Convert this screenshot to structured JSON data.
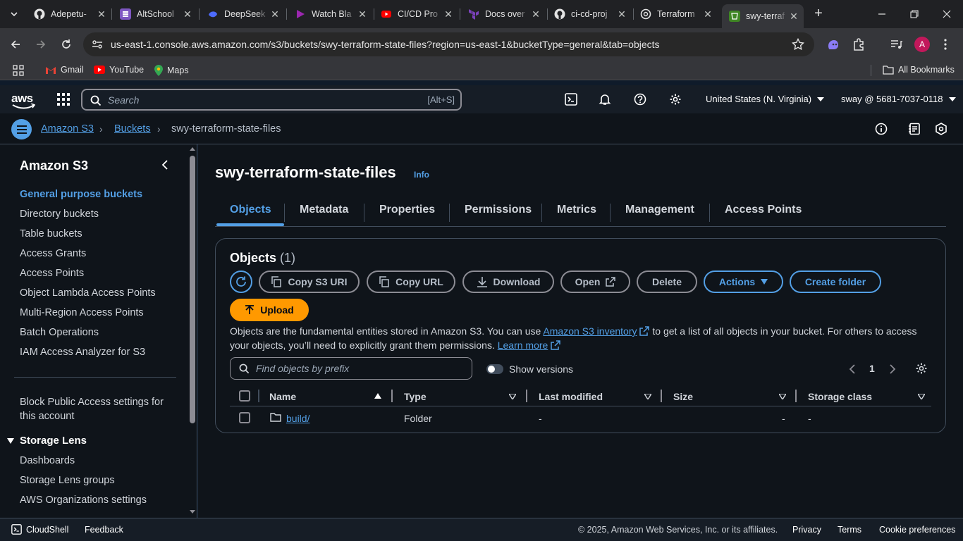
{
  "browser": {
    "tabs": [
      {
        "title": "Adepetu-",
        "icon": "github-icon",
        "color": "#e3e3e3"
      },
      {
        "title": "AltSchool",
        "icon": "altschool-icon",
        "color": "#7e57c2"
      },
      {
        "title": "DeepSeek",
        "icon": "deepseek-icon",
        "color": "#4d6bfe"
      },
      {
        "title": "Watch Bla",
        "icon": "play-icon",
        "color": "#9c27b0"
      },
      {
        "title": "CI/CD Pro",
        "icon": "youtube-icon",
        "color": "#ff0000"
      },
      {
        "title": "Docs over",
        "icon": "terraform-icon",
        "color": "#7b42bc"
      },
      {
        "title": "ci-cd-proj",
        "icon": "github-icon",
        "color": "#e3e3e3"
      },
      {
        "title": "Terraform",
        "icon": "openai-icon",
        "color": "#e3e3e3"
      },
      {
        "title": "swy-terraf",
        "icon": "s3-icon",
        "color": "#3f8624"
      }
    ],
    "url": "us-east-1.console.aws.amazon.com/s3/buckets/swy-terraform-state-files?region=us-east-1&bucketType=general&tab=objects",
    "profile_initial": "A",
    "bookmarks": [
      {
        "label": "Gmail",
        "icon": "gmail-icon"
      },
      {
        "label": "YouTube",
        "icon": "youtube-icon"
      },
      {
        "label": "Maps",
        "icon": "maps-icon"
      }
    ],
    "all_bookmarks": "All Bookmarks"
  },
  "aws": {
    "logo": "aws",
    "search_placeholder": "Search",
    "search_shortcut": "[Alt+S]",
    "region": "United States (N. Virginia)",
    "account": "sway @ 5681-7037-0118",
    "breadcrumbs": [
      "Amazon S3",
      "Buckets",
      "swy-terraform-state-files"
    ]
  },
  "sidebar": {
    "title": "Amazon S3",
    "items": [
      "General purpose buckets",
      "Directory buckets",
      "Table buckets",
      "Access Grants",
      "Access Points",
      "Object Lambda Access Points",
      "Multi-Region Access Points",
      "Batch Operations",
      "IAM Access Analyzer for S3"
    ],
    "block_public_access": "Block Public Access settings for this account",
    "storage_lens": {
      "title": "Storage Lens",
      "items": [
        "Dashboards",
        "Storage Lens groups",
        "AWS Organizations settings"
      ]
    }
  },
  "main": {
    "bucket_name": "swy-terraform-state-files",
    "info": "Info",
    "tabs": [
      "Objects",
      "Metadata",
      "Properties",
      "Permissions",
      "Metrics",
      "Management",
      "Access Points"
    ],
    "objects_title": "Objects",
    "objects_count": "(1)",
    "buttons": {
      "copy_s3_uri": "Copy S3 URI",
      "copy_url": "Copy URL",
      "download": "Download",
      "open": "Open",
      "delete": "Delete",
      "actions": "Actions",
      "create_folder": "Create folder",
      "upload": "Upload"
    },
    "description_1": "Objects are the fundamental entities stored in Amazon S3. You can use ",
    "inventory_link": "Amazon S3 inventory",
    "description_2": " to get a list of all objects in your bucket. For others to access your objects, you’ll need to explicitly grant them permissions. ",
    "learn_more": "Learn more",
    "search_placeholder": "Find objects by prefix",
    "show_versions": "Show versions",
    "page": "1",
    "columns": [
      "Name",
      "Type",
      "Last modified",
      "Size",
      "Storage class"
    ],
    "rows": [
      {
        "name": "build/",
        "type": "Folder",
        "last_modified": "-",
        "size": "-",
        "storage_class": "-"
      }
    ]
  },
  "footer": {
    "cloudshell": "CloudShell",
    "feedback": "Feedback",
    "copyright": "© 2025, Amazon Web Services, Inc. or its affiliates.",
    "privacy": "Privacy",
    "terms": "Terms",
    "cookies": "Cookie preferences"
  }
}
